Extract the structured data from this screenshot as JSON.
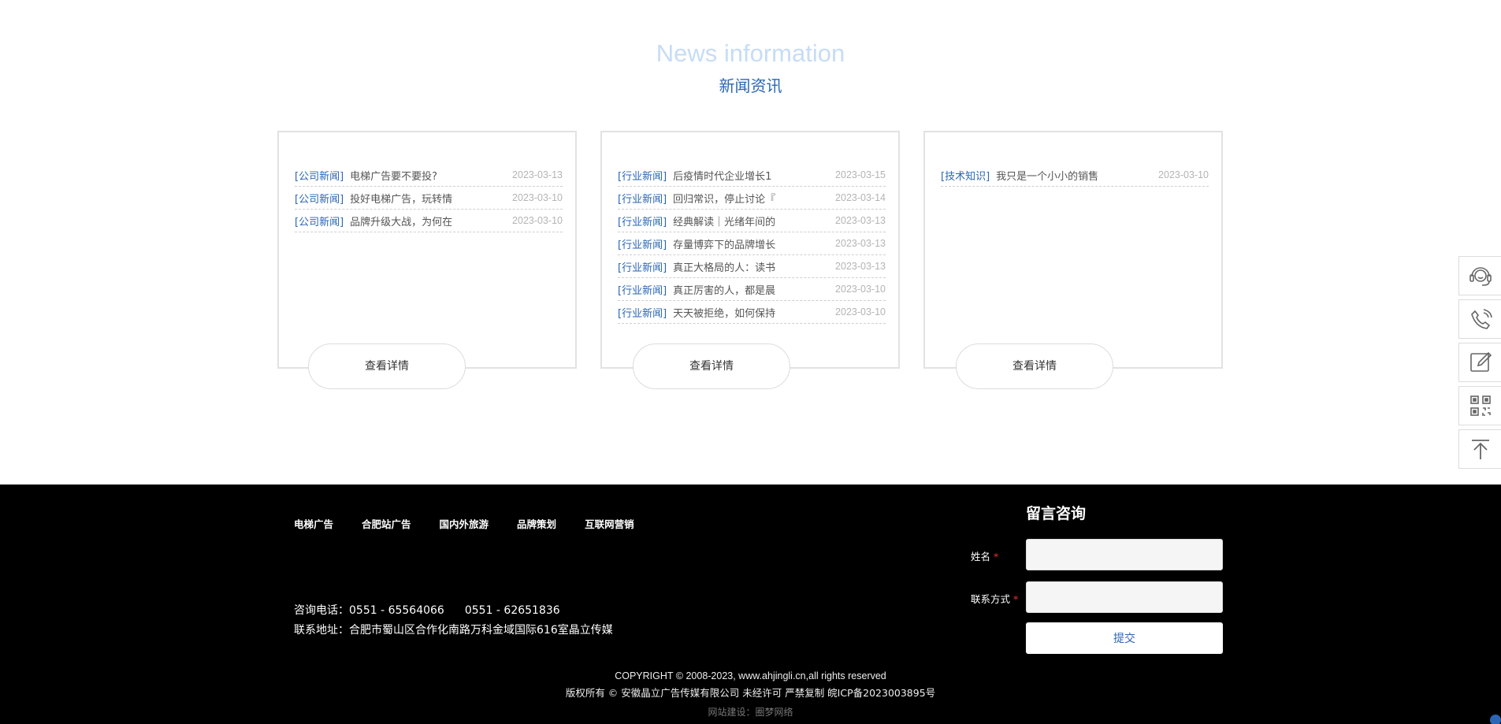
{
  "news": {
    "title_en": "News information",
    "title_cn": "新闻资讯",
    "more_label": "查看详情",
    "cards": [
      {
        "items": [
          {
            "tag": "[公司新闻]",
            "title": "电梯广告要不要投?",
            "date": "2023-03-13"
          },
          {
            "tag": "[公司新闻]",
            "title": "投好电梯广告，玩转情",
            "date": "2023-03-10"
          },
          {
            "tag": "[公司新闻]",
            "title": "品牌升级大战，为何在",
            "date": "2023-03-10"
          }
        ]
      },
      {
        "items": [
          {
            "tag": "[行业新闻]",
            "title": "后疫情时代企业增长1",
            "date": "2023-03-15"
          },
          {
            "tag": "[行业新闻]",
            "title": "回归常识，停止讨论『",
            "date": "2023-03-14"
          },
          {
            "tag": "[行业新闻]",
            "title": "经典解读｜光绪年间的",
            "date": "2023-03-13"
          },
          {
            "tag": "[行业新闻]",
            "title": "存量博弈下的品牌增长",
            "date": "2023-03-13"
          },
          {
            "tag": "[行业新闻]",
            "title": "真正大格局的人：读书",
            "date": "2023-03-13"
          },
          {
            "tag": "[行业新闻]",
            "title": "真正厉害的人，都是晨",
            "date": "2023-03-10"
          },
          {
            "tag": "[行业新闻]",
            "title": "天天被拒绝，如何保持",
            "date": "2023-03-10"
          }
        ]
      },
      {
        "items": [
          {
            "tag": "[技术知识]",
            "title": "我只是一个小小的销售",
            "date": "2023-03-10"
          }
        ]
      }
    ]
  },
  "sidebar": {
    "icons": [
      "headset-icon",
      "phone-icon",
      "edit-icon",
      "qrcode-icon",
      "back-to-top-icon"
    ]
  },
  "footer": {
    "nav": [
      "电梯广告",
      "合肥站广告",
      "国内外旅游",
      "品牌策划",
      "互联网营销"
    ],
    "phone_label": "咨询电话：",
    "phone_1": "0551 - 65564066",
    "phone_2": "0551 - 62651836",
    "address_label": "联系地址：",
    "address": "合肥市蜀山区合作化南路万科金域国际616室晶立传媒",
    "form": {
      "title": "留言咨询",
      "name_label": "姓名",
      "contact_label": "联系方式",
      "required_mark": "*",
      "submit_label": "提交"
    },
    "copyright": "COPYRIGHT © 2008-2023, www.ahjingli.cn,all rights reserved",
    "rights_line": "版权所有 © 安徽晶立广告传媒有限公司 未经许可 严禁复制 皖ICP备2023003895号",
    "builder_label": "网站建设：",
    "builder_name": "圈梦网络"
  },
  "colors": {
    "accent_blue": "#2a66b4",
    "heading_light_blue": "#c6dcf6",
    "footer_bg": "#000000",
    "required_red": "#e53030"
  }
}
